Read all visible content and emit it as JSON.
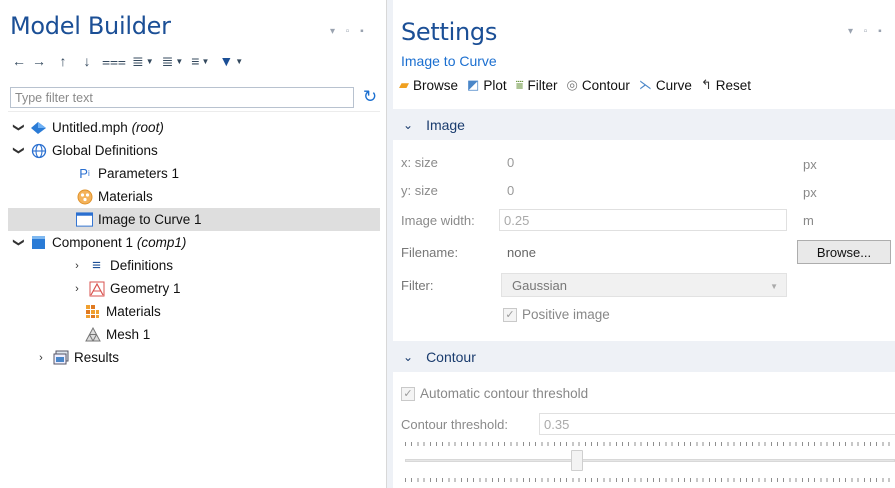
{
  "left_panel": {
    "title": "Model Builder",
    "window_controls": "▾ ▫ ▪",
    "toolbar": [
      {
        "icon": "arrow-left-icon",
        "glyph": "←"
      },
      {
        "icon": "arrow-right-icon",
        "glyph": "→"
      },
      {
        "icon": "arrow-up-icon",
        "glyph": "↑"
      },
      {
        "icon": "arrow-down-icon",
        "glyph": "↓"
      },
      {
        "icon": "show-icon",
        "glyph": "⩶"
      },
      {
        "icon": "expand-icon",
        "glyph": "≣"
      },
      {
        "icon": "collapse-icon",
        "glyph": "≣"
      },
      {
        "icon": "view-icon",
        "glyph": "≡"
      },
      {
        "icon": "pin-icon",
        "glyph": "▼"
      }
    ],
    "filter_placeholder": "Type filter text",
    "tree": [
      {
        "label": "Untitled.mph",
        "suffix": "(root)",
        "expanded": true,
        "depth": 0
      },
      {
        "label": "Global Definitions",
        "suffix": "",
        "expanded": true,
        "depth": 1
      },
      {
        "label": "Parameters 1",
        "suffix": "",
        "depth": 2
      },
      {
        "label": "Materials",
        "suffix": "",
        "depth": 2
      },
      {
        "label": "Image to Curve 1",
        "suffix": "",
        "depth": 2,
        "selected": true
      },
      {
        "label": "Component 1",
        "suffix": "(comp1)",
        "expanded": true,
        "depth": 1
      },
      {
        "label": "Definitions",
        "suffix": "",
        "collapsed": true,
        "depth": 2
      },
      {
        "label": "Geometry 1",
        "suffix": "",
        "collapsed": true,
        "depth": 2
      },
      {
        "label": "Materials",
        "suffix": "",
        "depth": 2
      },
      {
        "label": "Mesh 1",
        "suffix": "",
        "depth": 2
      },
      {
        "label": "Results",
        "suffix": "",
        "collapsed": true,
        "depth": 1
      }
    ]
  },
  "right_panel": {
    "title": "Settings",
    "window_controls": "▾ ▫ ▪",
    "subtitle": "Image to Curve",
    "toolbar": {
      "browse": "Browse",
      "plot": "Plot",
      "filter": "Filter",
      "contour": "Contour",
      "curve": "Curve",
      "reset": "Reset"
    },
    "image_section": {
      "title": "Image",
      "x_size_label": "x: size",
      "x_size_value": "0",
      "x_size_unit": "px",
      "y_size_label": "y: size",
      "y_size_value": "0",
      "y_size_unit": "px",
      "image_width_label": "Image width:",
      "image_width_value": "0.25",
      "image_width_unit": "m",
      "filename_label": "Filename:",
      "filename_value": "none",
      "browse_button": "Browse...",
      "filter_label": "Filter:",
      "filter_value": "Gaussian",
      "positive_image_label": "Positive image",
      "positive_image_checked": true
    },
    "contour_section": {
      "title": "Contour",
      "auto_threshold_label": "Automatic contour threshold",
      "auto_threshold_checked": true,
      "threshold_label": "Contour threshold:",
      "threshold_value": "0.35",
      "slider_value": 0.35
    }
  }
}
